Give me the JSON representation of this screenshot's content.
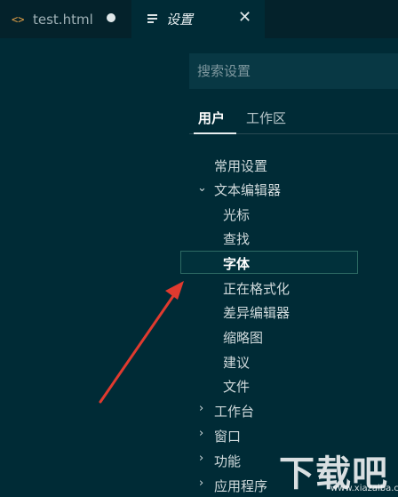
{
  "tabs": [
    {
      "label": "test.html",
      "icon": "code-icon",
      "modified": true
    },
    {
      "label": "设置",
      "icon": "menu-icon",
      "active": true
    }
  ],
  "search": {
    "placeholder": "搜索设置"
  },
  "scope_tabs": [
    "用户",
    "工作区"
  ],
  "tree": {
    "common": "常用设置",
    "text_editor": {
      "label": "文本编辑器",
      "children": [
        "光标",
        "查找",
        "字体",
        "正在格式化",
        "差异编辑器",
        "缩略图",
        "建议",
        "文件"
      ]
    },
    "collapsed": [
      "工作台",
      "窗口",
      "功能",
      "应用程序"
    ],
    "selected": "字体"
  },
  "watermark": {
    "text": "下载吧",
    "domain": "www.xiazaiba.com"
  },
  "colors": {
    "background": "#002b36",
    "tabbar": "#04222b",
    "accent": "#e03a2f"
  }
}
